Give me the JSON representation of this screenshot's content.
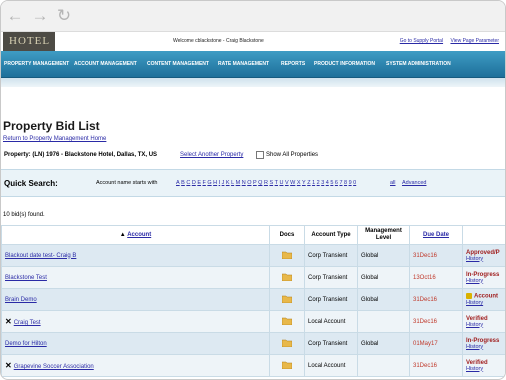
{
  "browser": {
    "back_icon": "arrow-left-icon",
    "forward_icon": "arrow-right-icon",
    "reload_icon": "reload-icon"
  },
  "site": {
    "logo_text": "HOTEL",
    "welcome": "Welcome cblackstone - Craig Blackstone",
    "top_links": [
      "Go to Supply Portal",
      "View Page Parameter"
    ]
  },
  "menu": [
    "PROPERTY MANAGEMENT",
    "ACCOUNT MANAGEMENT",
    "CONTENT MANAGEMENT",
    "RATE MANAGEMENT",
    "REPORTS",
    "PRODUCT INFORMATION",
    "SYSTEM ADMINISTRATION"
  ],
  "page": {
    "title": "Property Bid List",
    "return_link": "Return to Property Management Home",
    "property_label": "Property:",
    "property_value": "(LN) 1976 - Blackstone Hotel, Dallas, TX, US",
    "select_another": "Select Another Property",
    "show_all": "Show All Properties"
  },
  "quick_search": {
    "label": "Quick Search:",
    "account_prefix": "Account name starts with",
    "letters": [
      "A",
      "B",
      "C",
      "D",
      "E",
      "F",
      "G",
      "H",
      "I",
      "J",
      "K",
      "L",
      "M",
      "N",
      "O",
      "P",
      "Q",
      "R",
      "S",
      "T",
      "U",
      "V",
      "W",
      "X",
      "Y",
      "Z",
      "1",
      "2",
      "3",
      "4",
      "5",
      "6",
      "7",
      "8",
      "9",
      "0"
    ],
    "all": "all",
    "advanced": "Advanced"
  },
  "results": {
    "count_text": "10 bid(s) found."
  },
  "table": {
    "headers": {
      "account": "Account",
      "docs": "Docs",
      "account_type": "Account Type",
      "management_level": "Management Level",
      "due_date": "Due Date"
    },
    "rows": [
      {
        "icon": "",
        "account": "Blackout date test- Craig B",
        "type": "Corp Transient",
        "level": "Global",
        "due": "31Dec16",
        "status": "Approved/P",
        "status_icon": "",
        "history": "History"
      },
      {
        "icon": "",
        "account": "Blackstone Test",
        "type": "Corp Transient",
        "level": "Global",
        "due": "13Oct16",
        "status": "In-Progress",
        "status_icon": "",
        "history": "History"
      },
      {
        "icon": "",
        "account": "Brain Demo",
        "type": "Corp Transient",
        "level": "Global",
        "due": "31Dec16",
        "status": "Account",
        "status_icon": "lock-icon",
        "history": "History"
      },
      {
        "icon": "close-icon",
        "account": "Craig Test",
        "type": "Local Account",
        "level": "",
        "due": "31Dec16",
        "status": "Verified",
        "status_icon": "",
        "history": "History"
      },
      {
        "icon": "",
        "account": "Demo for Hilton",
        "type": "Corp Transient",
        "level": "Global",
        "due": "01May17",
        "status": "In-Progress",
        "status_icon": "",
        "history": "History"
      },
      {
        "icon": "close-icon",
        "account": "Grapevine Soccer Association",
        "type": "Local Account",
        "level": "",
        "due": "31Dec16",
        "status": "Verified",
        "status_icon": "",
        "history": "History"
      }
    ]
  },
  "colors": {
    "menu_bar": "#1d6f9a",
    "link": "#2a2aa6",
    "due_date": "#c0392b",
    "status": "#a01f1f",
    "row_alt": "#dde9f2"
  }
}
